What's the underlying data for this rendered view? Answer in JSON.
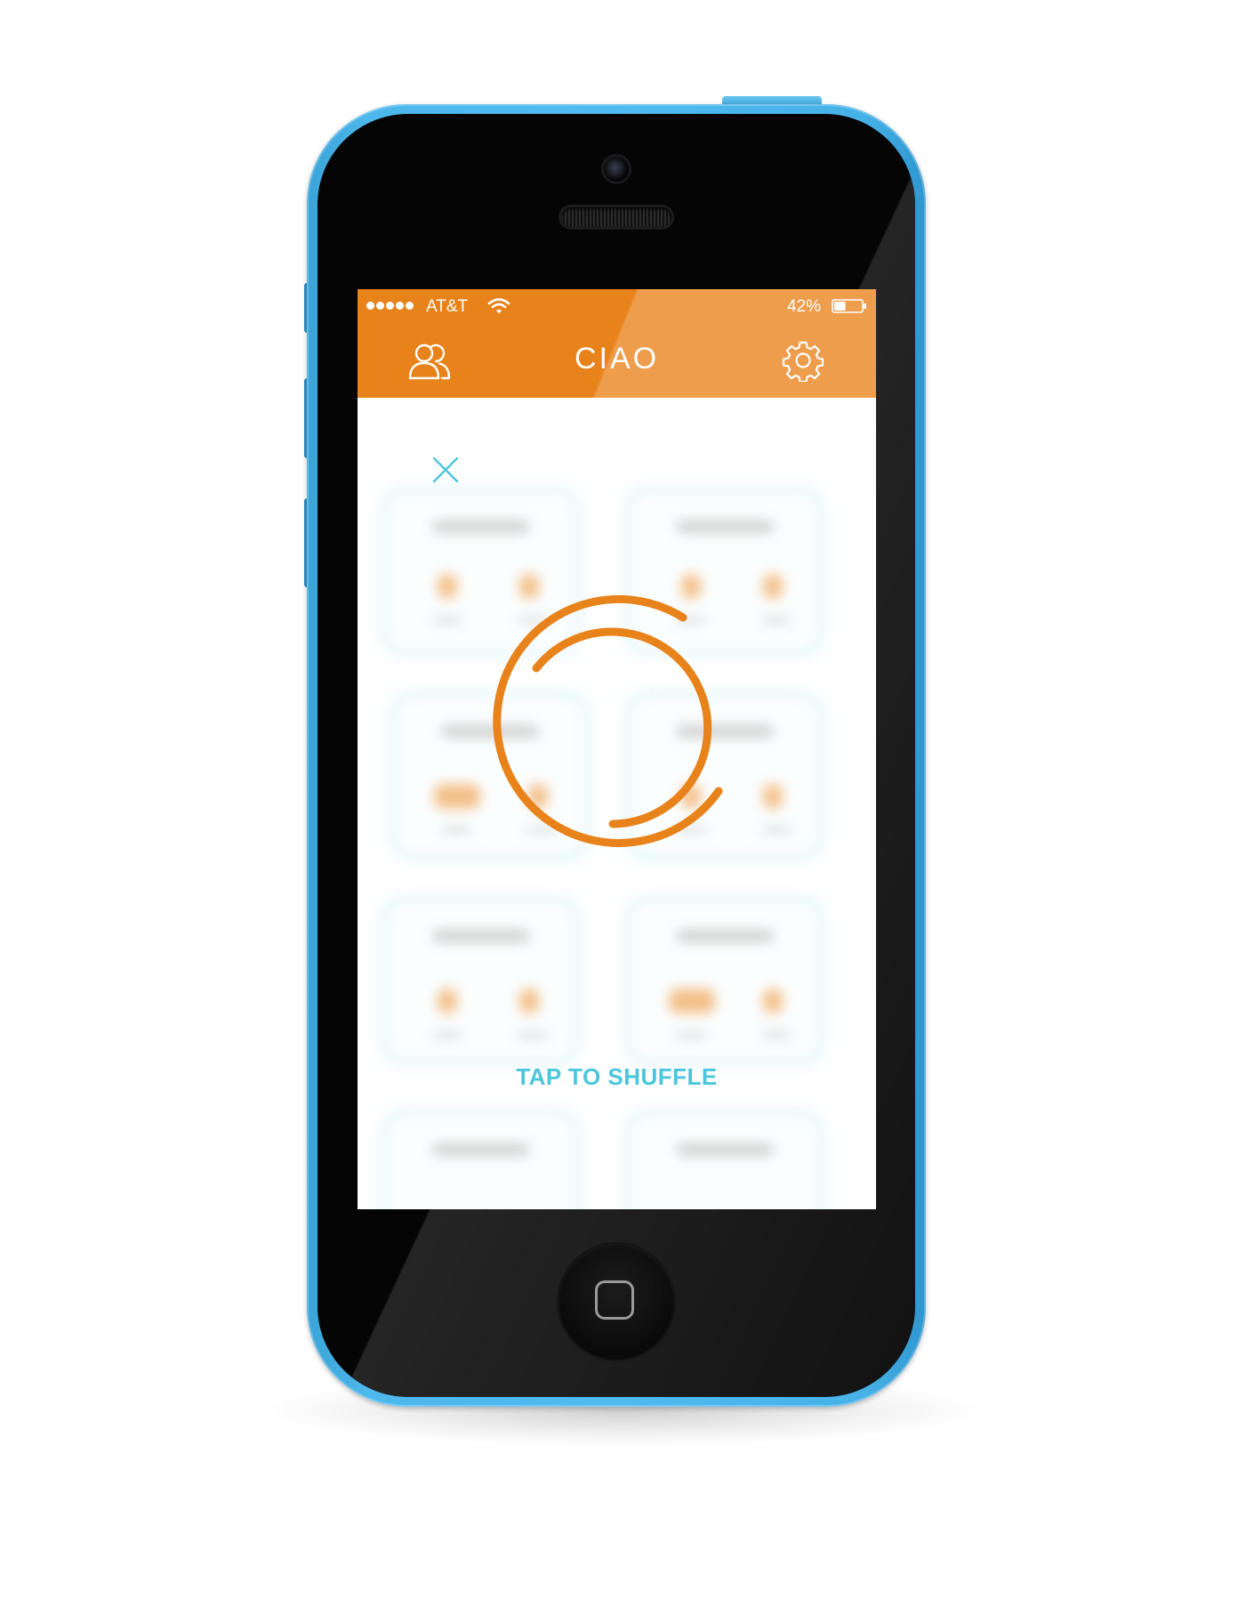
{
  "status_bar": {
    "carrier": "AT&T",
    "signal_bars": 5,
    "battery_percent": "42%",
    "battery_level": 0.42
  },
  "header": {
    "title": "CIAO",
    "left_icon": "friends-icon",
    "right_icon": "gear-icon"
  },
  "main": {
    "close_icon": "close-icon",
    "loader_icon": "shuffle-spinner-icon",
    "shuffle_label": "TAP TO SHUFFLE"
  },
  "colors": {
    "brand_orange": "#e8821a",
    "accent_teal": "#4cc6dc",
    "device_blue": "#4fbaef"
  }
}
